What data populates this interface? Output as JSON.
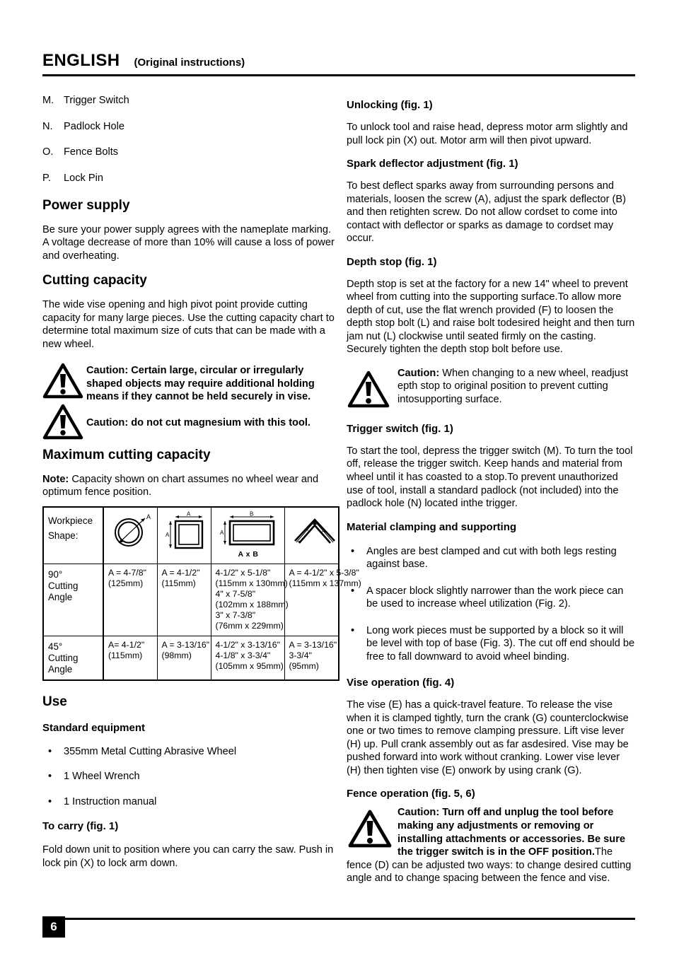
{
  "header": {
    "language": "ENGLISH",
    "subtitle": "(Original instructions)"
  },
  "left_column": {
    "part_list": [
      {
        "key": "M.",
        "label": "Trigger Switch"
      },
      {
        "key": "N.",
        "label": "Padlock Hole"
      },
      {
        "key": "O.",
        "label": "Fence Bolts"
      },
      {
        "key": "P.",
        "label": "Lock Pin"
      }
    ],
    "power_supply": {
      "heading": "Power supply",
      "body": "Be sure your power supply agrees with the nameplate marking. A voltage decrease of more than 10% will cause a loss of power and overheating."
    },
    "cutting_capacity": {
      "heading": "Cutting capacity",
      "body": "The wide vise opening and high pivot point provide cutting capacity for many large pieces. Use the cutting capacity chart to determine total maximum size of cuts that can be made with a new wheel."
    },
    "caution_1": "Caution: Certain large, circular or irregularly shaped objects may require additional holding means if they cannot be held securely in vise.",
    "caution_2": "Caution: do not cut magnesium with this tool.",
    "maximum_cutting_capacity": {
      "heading": "Maximum cutting capacity",
      "note_label": "Note:",
      "note_text": " Capacity shown on chart assumes no wheel wear and optimum fence position."
    },
    "use": {
      "heading": "Use",
      "standard_equipment_heading": "Standard equipment",
      "standard_equipment": [
        "355mm Metal Cutting Abrasive Wheel",
        "1 Wheel Wrench",
        "1 Instruction manual"
      ],
      "to_carry_heading": "To carry (fig. 1)",
      "to_carry_body": "Fold down unit to position where you can carry the saw. Push in lock pin (X) to lock arm down."
    }
  },
  "capacity_table": {
    "shape_label_line1": "Workpiece",
    "shape_label_line2": "Shape:",
    "shapes": {
      "round": "round-tube-shape",
      "square": "square-tube-shape",
      "rectangle": "rectangular-tube-shape",
      "angle": "angle-bracket-shape"
    },
    "rectangle_caption": "A x B",
    "dim_a": "A",
    "dim_b": "B",
    "rows": [
      {
        "label_line1": "90°",
        "label_line2": "Cutting",
        "label_line3": "Angle",
        "round": [
          "A = 4-7/8\"",
          "(125mm)"
        ],
        "square": [
          "A = 4-1/2\"",
          "(115mm)"
        ],
        "rectangle": [
          "4-1/2\" x 5-1/8\"",
          "(115mm x 130mm)",
          "4\" x 7-5/8\"",
          "(102mm x 188mm)",
          "3\" x 7-3/8\"",
          "(76mm x 229mm)"
        ],
        "angle": [
          "A = 4-1/2\" x 5-3/8\"",
          "(115mm x 137mm)"
        ]
      },
      {
        "label_line1": "45°",
        "label_line2": "Cutting",
        "label_line3": "Angle",
        "round": [
          "A= 4-1/2\"",
          "(115mm)"
        ],
        "square": [
          "A = 3-13/16\"",
          "(98mm)"
        ],
        "rectangle": [
          "4-1/2\" x 3-13/16\"",
          "4-1/8\" x 3-3/4\"",
          "(105mm x 95mm)"
        ],
        "angle": [
          "A = 3-13/16\"",
          "3-3/4\"",
          "(95mm)"
        ]
      }
    ]
  },
  "right_column": {
    "unlocking": {
      "heading": "Unlocking (fig. 1)",
      "body": "To unlock tool and raise head, depress motor arm slightly and pull lock pin (X) out. Motor arm will then pivot upward."
    },
    "spark_deflector": {
      "heading": "Spark deflector adjustment (fig. 1)",
      "body": "To best deflect sparks away from surrounding persons and materials, loosen the screw (A), adjust the spark deflector (B) and then retighten screw. Do not allow cordset to come into contact with deflector or sparks as damage to cordset may occur."
    },
    "depth_stop": {
      "heading": "Depth stop (fig. 1)",
      "body": "Depth stop is set at the factory for a new 14\" wheel to prevent wheel from cutting into the supporting surface.To allow more depth of cut, use the flat wrench provided (F) to loosen the depth stop bolt (L) and raise bolt todesired height and then turn jam nut (L) clockwise until seated firmly on the casting. Securely tighten the depth stop bolt before use.",
      "caution_bold": "Caution:",
      "caution_rest": " When changing to a new wheel, readjust epth stop to original position to prevent cutting intosupporting surface."
    },
    "trigger_switch": {
      "heading": "Trigger switch (fig. 1)",
      "body": "To start the tool, depress the trigger switch (M). To turn the tool off, release the trigger switch. Keep hands and material from wheel until it has coasted to a stop.To prevent unauthorized use of tool, install a standard padlock (not included) into the padlock hole (N) located inthe trigger."
    },
    "material_clamping": {
      "heading": "Material clamping and supporting",
      "bullets": [
        "Angles are best clamped and cut with both legs resting against base.",
        "A spacer block slightly narrower than the work piece can be used to increase wheel utilization (Fig. 2).",
        "Long work pieces must be supported by a block so it will be level with top of base (Fig. 3). The cut off end should be free to fall downward to avoid wheel binding."
      ]
    },
    "vise_operation": {
      "heading": "Vise operation (fig. 4)",
      "body": "The vise (E) has a quick-travel feature. To release the vise when it is clamped tightly, turn the crank (G) counterclockwise one or two times to remove clamping pressure. Lift vise lever (H) up. Pull crank assembly out as far asdesired. Vise may be pushed forward into work without cranking. Lower vise lever (H) then tighten vise (E) onwork by using crank (G)."
    },
    "fence_operation": {
      "heading": "Fence operation (fig. 5, 6)",
      "caution_bold": "Caution: Turn off and unplug the tool before making any adjustments or removing or installing attachments or accessories. Be sure the trigger switch is in the OFF position.",
      "caution_rest": "The fence (D) can be adjusted two ways: to change desired cutting angle and to change spacing between the fence and vise."
    }
  },
  "footer": {
    "page_number": "6"
  }
}
